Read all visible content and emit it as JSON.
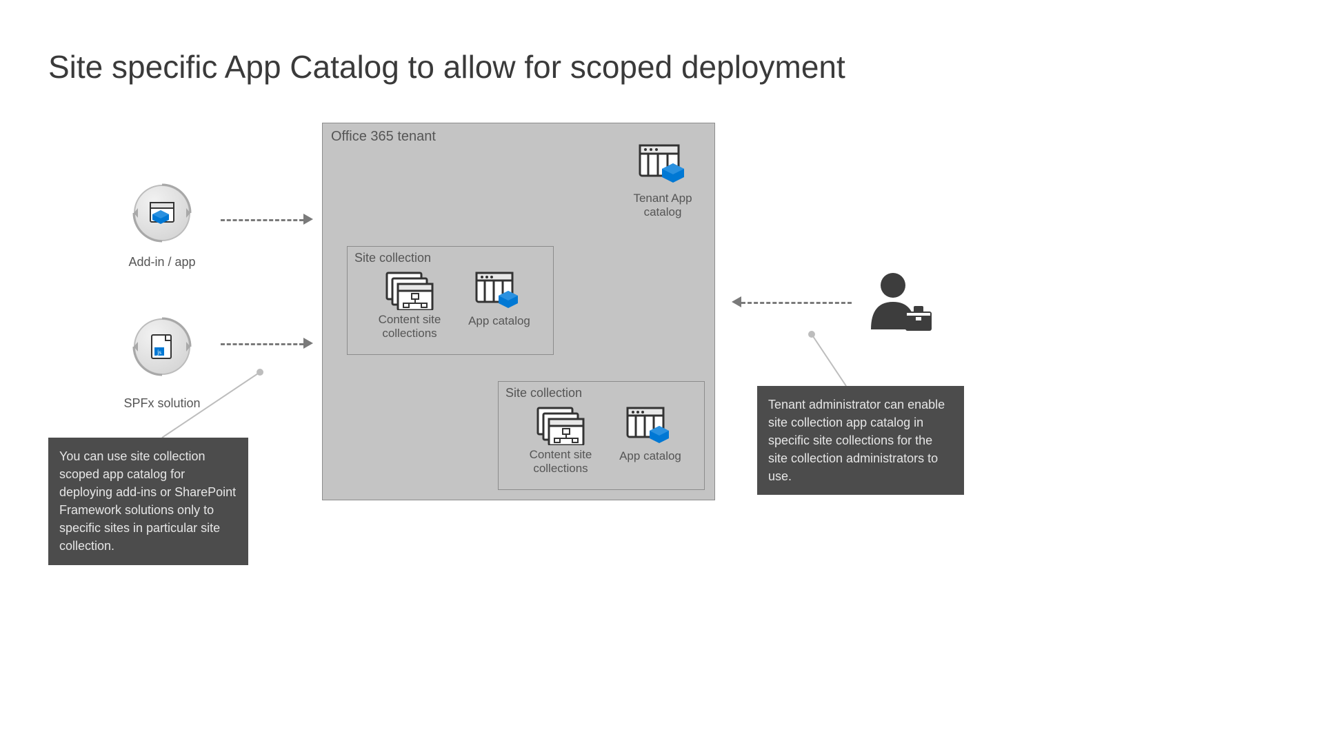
{
  "title": "Site specific App Catalog to allow for scoped deployment",
  "tenant": {
    "label": "Office 365 tenant"
  },
  "tenantApp": {
    "label": "Tenant App catalog"
  },
  "siteCollections": {
    "label": "Site collection",
    "content": "Content site collections",
    "appcatalog": "App catalog"
  },
  "left": {
    "addin": "Add-in / app",
    "spfx": "SPFx solution"
  },
  "notes": {
    "left": "You can use site collection scoped app catalog for deploying add-ins or SharePoint Framework solutions only to specific sites in particular site collection.",
    "right": "Tenant administrator can enable site collection app catalog in specific site collections for the site collection administrators to use."
  },
  "icons": {
    "addin": "addin-circle-icon",
    "spfx": "spfx-circle-icon",
    "tenantApp": "app-catalog-icon",
    "content": "content-sites-icon",
    "appcatalog": "app-catalog-icon",
    "admin": "admin-person-icon"
  }
}
